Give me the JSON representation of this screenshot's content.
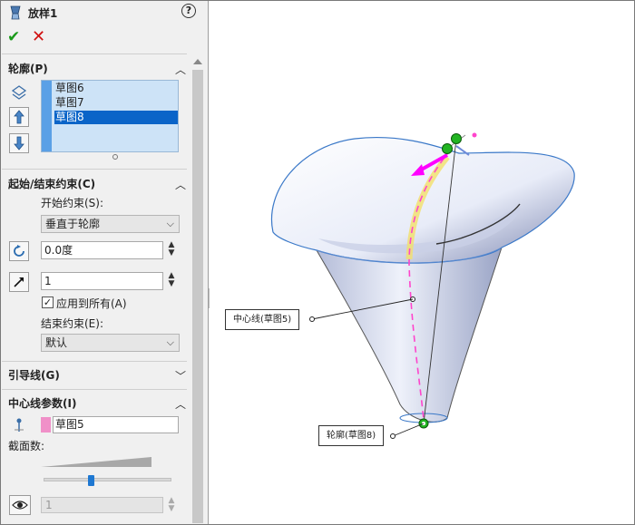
{
  "feature": {
    "title": "放样1",
    "help_glyph": "?",
    "ok_glyph": "✔",
    "cancel_glyph": "✕"
  },
  "profiles": {
    "header": "轮廓(P)",
    "items": [
      "草图6",
      "草图7",
      "草图8"
    ],
    "selected_index": 2
  },
  "constraints": {
    "header": "起始/结束约束(C)",
    "start_label": "开始约束(S):",
    "start_value": "垂直于轮廓",
    "angle_value": "0.0度",
    "length_value": "1",
    "apply_all_label": "应用到所有(A)",
    "apply_all_checked": true,
    "end_label": "结束约束(E):",
    "end_value": "默认"
  },
  "guides": {
    "header": "引导线(G)"
  },
  "centerline": {
    "header": "中心线参数(I)",
    "sketch": "草图5",
    "sections_label": "截面数:",
    "sections_slider_fraction": 0.37,
    "preview_value": "1",
    "swatch_color": "#f090c8"
  },
  "viewport": {
    "callout_centerline": "中心线(草图5)",
    "callout_profile": "轮廓(草图8)",
    "colors": {
      "accent": "#0a64c8",
      "magenta": "#ff00ff",
      "handle_green": "#22b422"
    }
  },
  "glyphs": {
    "collapse": "︿",
    "expand": "﹀",
    "dropdown": "⌵",
    "spin_up": "▲",
    "spin_down": "▼",
    "check": "✓"
  }
}
